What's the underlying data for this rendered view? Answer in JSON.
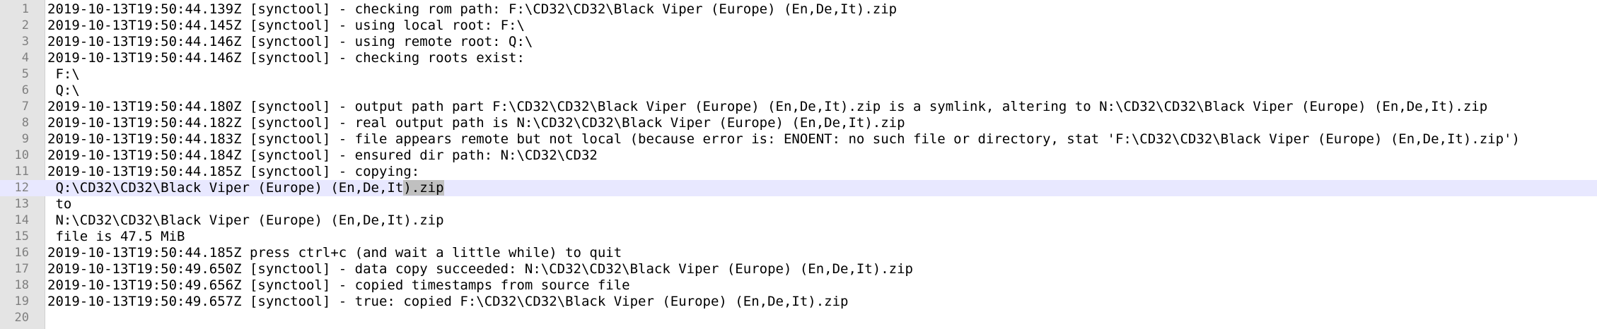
{
  "editor": {
    "current_line": 12,
    "lines": [
      {
        "num": "1",
        "text": "2019-10-13T19:50:44.139Z [synctool] - checking rom path: F:\\CD32\\CD32\\Black Viper (Europe) (En,De,It).zip"
      },
      {
        "num": "2",
        "text": "2019-10-13T19:50:44.145Z [synctool] - using local root: F:\\"
      },
      {
        "num": "3",
        "text": "2019-10-13T19:50:44.146Z [synctool] - using remote root: Q:\\"
      },
      {
        "num": "4",
        "text": "2019-10-13T19:50:44.146Z [synctool] - checking roots exist:"
      },
      {
        "num": "5",
        "text": " F:\\"
      },
      {
        "num": "6",
        "text": " Q:\\"
      },
      {
        "num": "7",
        "text": "2019-10-13T19:50:44.180Z [synctool] - output path part F:\\CD32\\CD32\\Black Viper (Europe) (En,De,It).zip is a symlink, altering to N:\\CD32\\CD32\\Black Viper (Europe) (En,De,It).zip"
      },
      {
        "num": "8",
        "text": "2019-10-13T19:50:44.182Z [synctool] - real output path is N:\\CD32\\CD32\\Black Viper (Europe) (En,De,It).zip"
      },
      {
        "num": "9",
        "text": "2019-10-13T19:50:44.183Z [synctool] - file appears remote but not local (because error is: ENOENT: no such file or directory, stat 'F:\\CD32\\CD32\\Black Viper (Europe) (En,De,It).zip')"
      },
      {
        "num": "10",
        "text": "2019-10-13T19:50:44.184Z [synctool] - ensured dir path: N:\\CD32\\CD32"
      },
      {
        "num": "11",
        "text": "2019-10-13T19:50:44.185Z [synctool] - copying:"
      },
      {
        "num": "12",
        "text_before": " Q:\\CD32\\CD32\\Black Viper (Europe) (En,De,It",
        "text_selected": ").zip",
        "text_after": ""
      },
      {
        "num": "13",
        "text": " to"
      },
      {
        "num": "14",
        "text": " N:\\CD32\\CD32\\Black Viper (Europe) (En,De,It).zip"
      },
      {
        "num": "15",
        "text": " file is 47.5 MiB"
      },
      {
        "num": "16",
        "text": "2019-10-13T19:50:44.185Z press ctrl+c (and wait a little while) to quit"
      },
      {
        "num": "17",
        "text": "2019-10-13T19:50:49.650Z [synctool] - data copy succeeded: N:\\CD32\\CD32\\Black Viper (Europe) (En,De,It).zip"
      },
      {
        "num": "18",
        "text": "2019-10-13T19:50:49.656Z [synctool] - copied timestamps from source file"
      },
      {
        "num": "19",
        "text": "2019-10-13T19:50:49.657Z [synctool] - true: copied F:\\CD32\\CD32\\Black Viper (Europe) (En,De,It).zip"
      },
      {
        "num": "20",
        "text": ""
      }
    ]
  }
}
